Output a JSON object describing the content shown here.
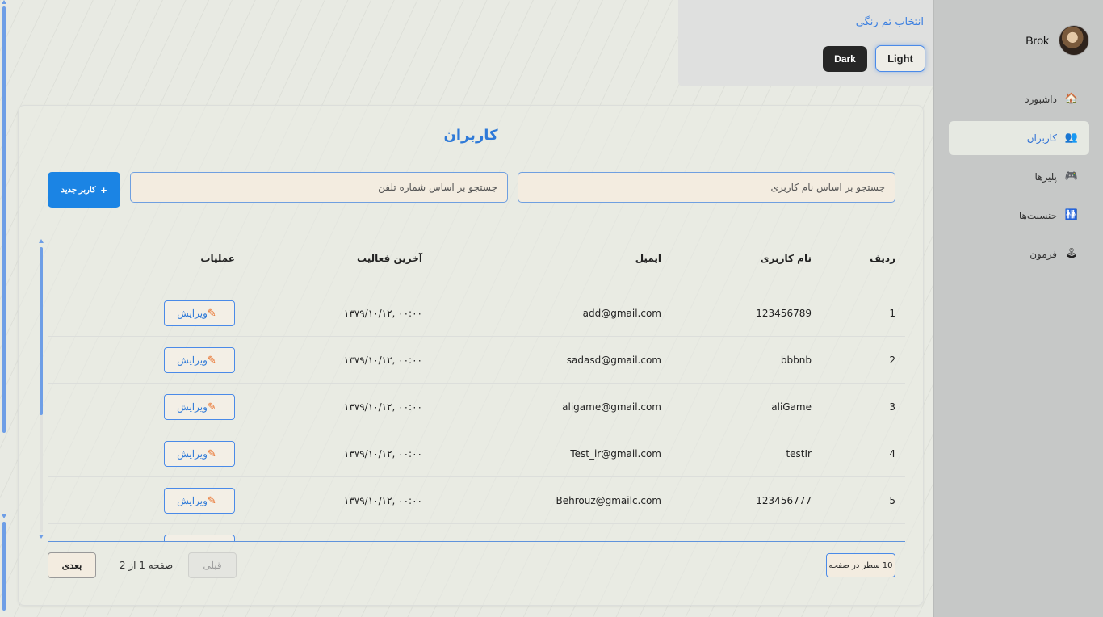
{
  "sidebar": {
    "user_name": "Brok",
    "items": [
      {
        "label": "داشبورد",
        "icon": "🏠"
      },
      {
        "label": "کاربران",
        "icon": "👥"
      },
      {
        "label": "پلیرها",
        "icon": "🎮"
      },
      {
        "label": "جنسیت‌ها",
        "icon": "🚻"
      },
      {
        "label": "فرمون",
        "icon": "🕹"
      }
    ],
    "active_item": "کاربران"
  },
  "theme": {
    "title": "انتخاب تم رنگی",
    "light_label": "Light",
    "dark_label": "Dark",
    "selected": "Light"
  },
  "main": {
    "title": "کاربران",
    "search_username_placeholder": "جستجو بر اساس نام کاربری",
    "search_phone_placeholder": "جستجو بر اساس شماره تلفن",
    "add_user_label": "کاربر جدید",
    "add_user_icon": "+"
  },
  "table": {
    "headers": {
      "index": "ردیف",
      "username": "نام کاربری",
      "email": "ایمیل",
      "last_activity": "آخرین فعالیت",
      "operations": "عملیات"
    },
    "edit_label": "ویرایش",
    "edit_icon": "✎",
    "rows": [
      {
        "index": "1",
        "username": "123456789",
        "email": "add@gmail.com",
        "last_activity": "۱۳۷۹/۱۰/۱۲, ۰۰:۰۰"
      },
      {
        "index": "2",
        "username": "bbbnb",
        "email": "sadasd@gmail.com",
        "last_activity": "۱۳۷۹/۱۰/۱۲, ۰۰:۰۰"
      },
      {
        "index": "3",
        "username": "aliGame",
        "email": "aligame@gmail.com",
        "last_activity": "۱۳۷۹/۱۰/۱۲, ۰۰:۰۰"
      },
      {
        "index": "4",
        "username": "testIr",
        "email": "Test_ir@gmail.com",
        "last_activity": "۱۳۷۹/۱۰/۱۲, ۰۰:۰۰"
      },
      {
        "index": "5",
        "username": "123456777",
        "email": "Behrouz@gmailc.com",
        "last_activity": "۱۳۷۹/۱۰/۱۲, ۰۰:۰۰"
      }
    ]
  },
  "pagination": {
    "rows_per_page": "10 سطر در صفحه",
    "prev_label": "قبلی",
    "next_label": "بعدی",
    "page_info": "صفحه 1 از 2"
  },
  "colors": {
    "accent": "#2f7ad8",
    "primary_button": "#1b84e4",
    "edit_icon": "#e9702a",
    "sidebar_bg": "#c6c8c7"
  }
}
